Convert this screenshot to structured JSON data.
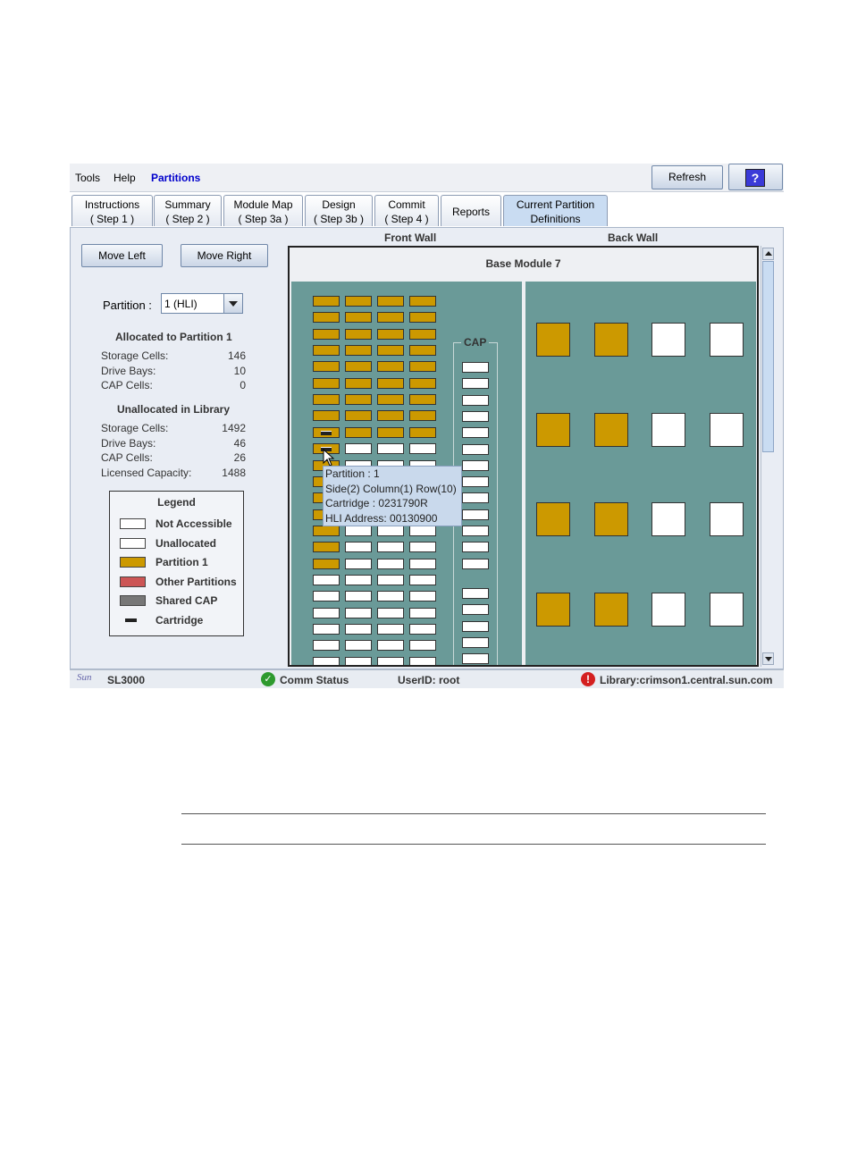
{
  "menu": {
    "tools": "Tools",
    "help": "Help",
    "partitions": "Partitions"
  },
  "toolbar": {
    "refresh": "Refresh",
    "help_icon": "?"
  },
  "tabs": [
    {
      "l1": "Instructions",
      "l2": "( Step 1 )"
    },
    {
      "l1": "Summary",
      "l2": "( Step 2 )"
    },
    {
      "l1": "Module Map",
      "l2": "( Step 3a )"
    },
    {
      "l1": "Design",
      "l2": "( Step 3b )"
    },
    {
      "l1": "Commit",
      "l2": "( Step 4 )"
    },
    {
      "l1": "Reports",
      "l2": ""
    },
    {
      "l1": "Current Partition",
      "l2": "Definitions"
    }
  ],
  "left": {
    "move_left": "Move Left",
    "move_right": "Move Right",
    "partition_label": "Partition :",
    "partition_value": "1 (HLI)",
    "allocated_title": "Allocated to Partition 1",
    "allocated": [
      {
        "label": "Storage Cells:",
        "value": "146"
      },
      {
        "label": "Drive Bays:",
        "value": "10"
      },
      {
        "label": "CAP Cells:",
        "value": "0"
      }
    ],
    "unallocated_title": "Unallocated in Library",
    "unallocated": [
      {
        "label": "Storage Cells:",
        "value": "1492"
      },
      {
        "label": "Drive Bays:",
        "value": "46"
      },
      {
        "label": "CAP Cells:",
        "value": "26"
      },
      {
        "label": "Licensed Capacity:",
        "value": "1488"
      }
    ]
  },
  "legend": {
    "title": "Legend",
    "items": [
      {
        "label": "Not Accessible",
        "type": "x"
      },
      {
        "label": "Unallocated",
        "type": "white"
      },
      {
        "label": "Partition  1",
        "type": "gold"
      },
      {
        "label": "Other Partitions",
        "type": "red"
      },
      {
        "label": "Shared CAP",
        "type": "gray"
      },
      {
        "label": "Cartridge",
        "type": "cart"
      }
    ]
  },
  "map": {
    "front_wall": "Front Wall",
    "back_wall": "Back  Wall",
    "module_title": "Base Module 7",
    "cap_label": "CAP"
  },
  "tooltip": {
    "line1": "Partition : 1",
    "line2": "Side(2) Column(1) Row(10)",
    "line3": "Cartridge : 0231790R",
    "line4": "HLI Address: 00130900"
  },
  "status": {
    "sun_logo": "Sun",
    "product": "SL3000",
    "comm": "Comm Status",
    "user": "UserID: root",
    "library": "Library:crimson1.central.sun.com"
  },
  "colors": {
    "gold": "#cc9900",
    "teal": "#6a9a98",
    "red": "#cc5555",
    "gray": "#777777",
    "accent": "#0000cc"
  }
}
